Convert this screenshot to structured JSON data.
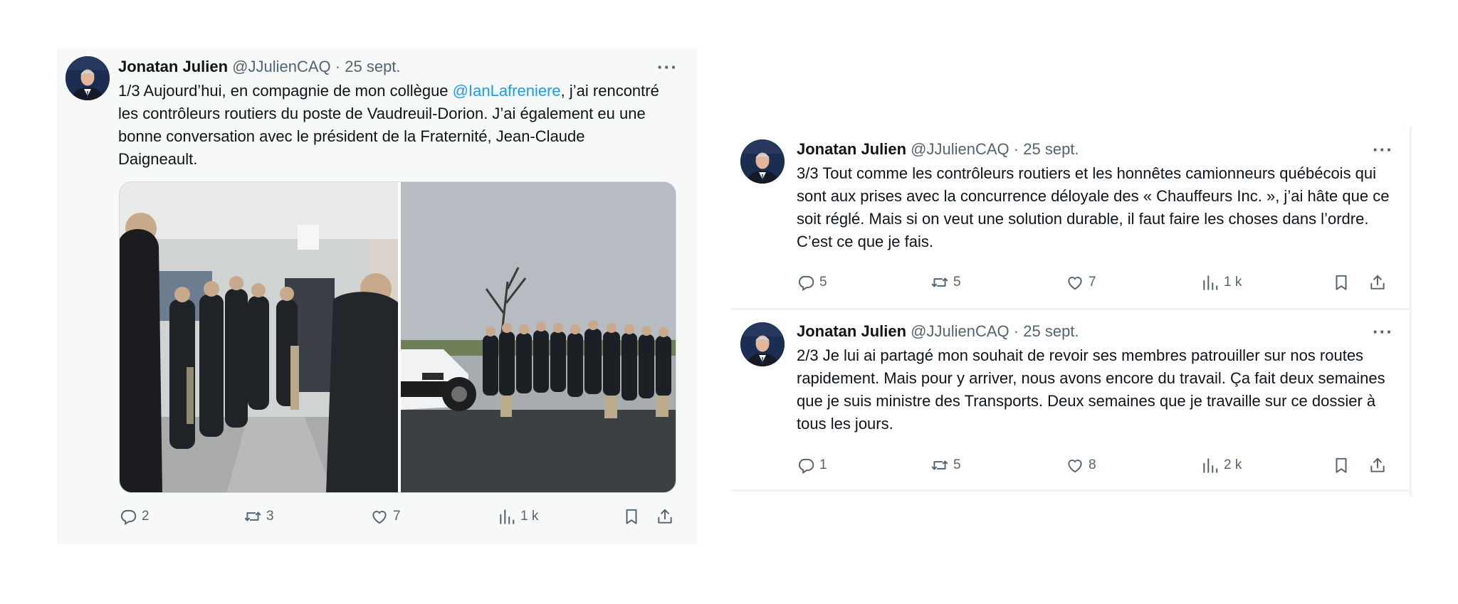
{
  "tweets": [
    {
      "author": "Jonatan Julien",
      "handle": "@JJulienCAQ",
      "separator": "·",
      "date": "25 sept.",
      "more": "···",
      "text_before": "1/3 Aujourd’hui, en compagnie de mon collègue ",
      "mention": "@IanLafreniere",
      "text_after": ", j’ai rencontré les contrôleurs routiers du poste de Vaudreuil-Dorion. J’ai également eu une bonne conversation avec le président de la Fraternité, Jean-Claude Daigneault.",
      "replies": "2",
      "retweets": "3",
      "likes": "7",
      "views": "1 k"
    },
    {
      "author": "Jonatan Julien",
      "handle": "@JJulienCAQ",
      "separator": "·",
      "date": "25 sept.",
      "more": "···",
      "text": "3/3 Tout comme les contrôleurs routiers et les honnêtes camionneurs québécois qui sont aux prises avec la concurrence déloyale des « Chauffeurs Inc. », j’ai hâte que ce soit réglé. Mais si on veut une solution durable, il faut faire les choses dans l’ordre. C’est ce que je fais.",
      "replies": "5",
      "retweets": "5",
      "likes": "7",
      "views": "1 k"
    },
    {
      "author": "Jonatan Julien",
      "handle": "@JJulienCAQ",
      "separator": "·",
      "date": "25 sept.",
      "more": "···",
      "text": "2/3 Je lui ai partagé mon souhait de revoir ses membres patrouiller sur nos routes rapidement. Mais pour y arriver, nous avons encore du travail. Ça fait deux semaines que je suis ministre des Transports. Deux semaines que je travaille sur ce dossier à tous les jours.",
      "replies": "1",
      "retweets": "5",
      "likes": "8",
      "views": "2 k"
    }
  ],
  "icons": {
    "reply": "reply-icon",
    "retweet": "retweet-icon",
    "like": "heart-icon",
    "views": "views-icon",
    "bookmark": "bookmark-icon",
    "share": "share-icon"
  },
  "colors": {
    "text": "#0f1419",
    "secondary": "#536471",
    "mention": "#1d9bf0",
    "card_left_bg": "#f7f9f9"
  }
}
